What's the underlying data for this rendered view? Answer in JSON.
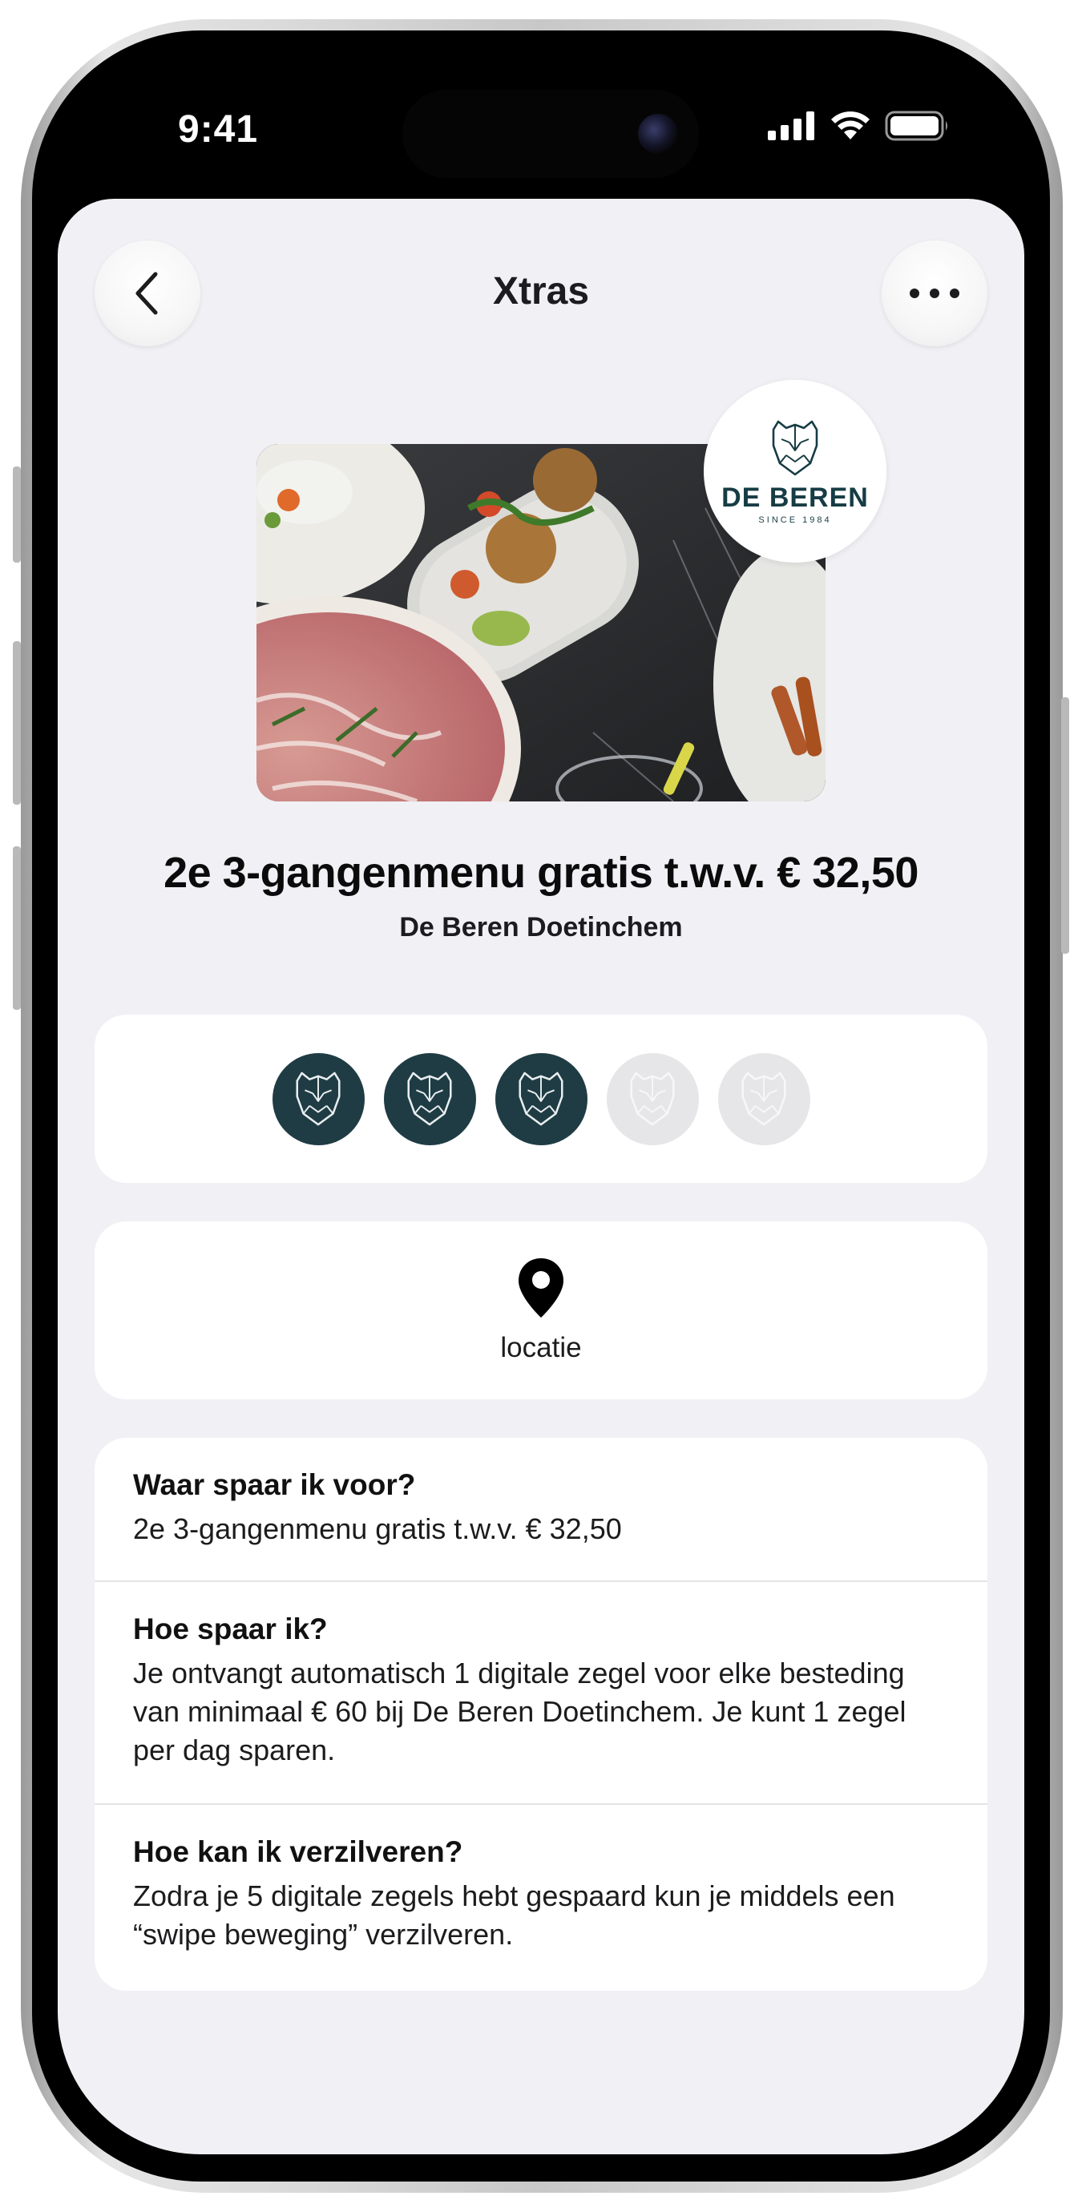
{
  "status_bar": {
    "time": "9:41"
  },
  "nav": {
    "title": "Xtras",
    "back_icon": "chevron-left-icon",
    "more_icon": "ellipsis-icon"
  },
  "brand": {
    "name": "DE BEREN",
    "since": "SINCE 1984",
    "logo_icon": "bear-head-icon",
    "color": "#1f3c44"
  },
  "offer": {
    "title": "2e 3-gangenmenu gratis t.w.v. € 32,50",
    "restaurant": "De Beren Doetinchem"
  },
  "stamps": {
    "total": 5,
    "collected": 3,
    "filled_color": "#1f3c44",
    "empty_color": "#e6e6e8"
  },
  "location": {
    "icon": "map-pin-icon",
    "label": "locatie"
  },
  "info": [
    {
      "heading": "Waar spaar ik voor?",
      "body": "2e 3-gangenmenu gratis t.w.v. € 32,50"
    },
    {
      "heading": "Hoe spaar ik?",
      "body": "Je ontvangt automatisch 1 digitale zegel voor elke besteding van minimaal € 60 bij De Beren Doetinchem. Je kunt 1 zegel per dag sparen."
    },
    {
      "heading": "Hoe kan ik verzilveren?",
      "body": "Zodra je 5 digitale zegels hebt gespaard kun je middels een “swipe beweging” verzilveren."
    }
  ]
}
